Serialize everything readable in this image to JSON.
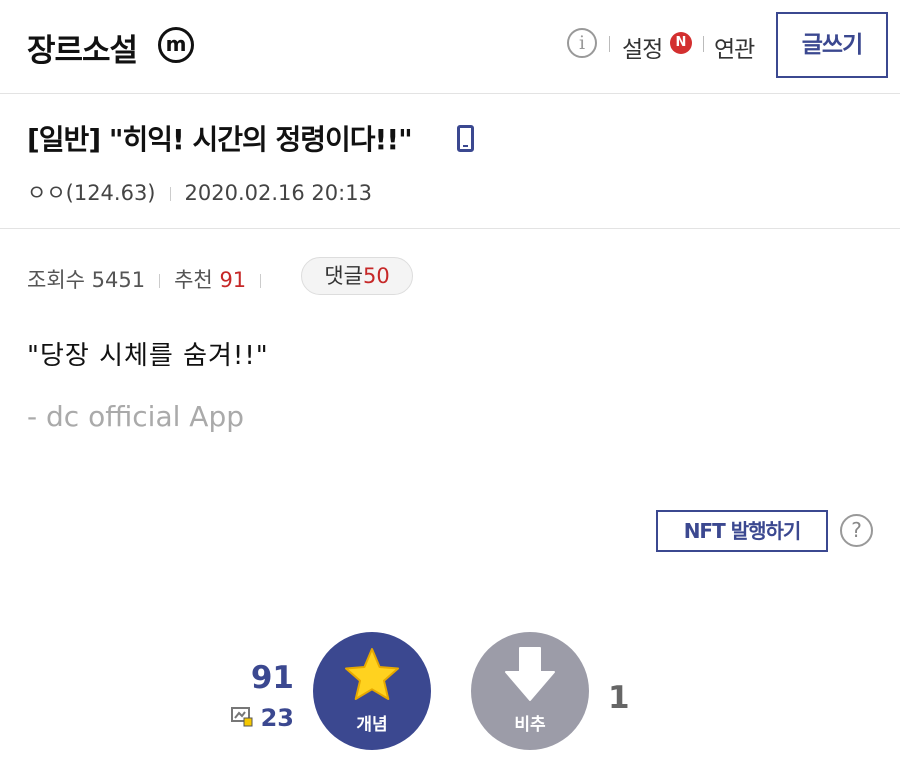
{
  "header": {
    "gallery_name": "장르소설",
    "minor_badge": "m",
    "info_icon": "i",
    "settings_label": "설정",
    "new_badge": "N",
    "related_label": "연관",
    "write_label": "글쓰기"
  },
  "post": {
    "title": "[일반] \"히익! 시간의 정령이다!!\"",
    "author": "ㅇㅇ(124.63)",
    "datetime": "2020.02.16 20:13",
    "views_label": "조회수",
    "views": "5451",
    "recommend_label": "추천",
    "recommend": "91",
    "comments_label": "댓글",
    "comments": "50",
    "body": "\"당장 시체를 숨겨!!\"",
    "signature": "- dc official App"
  },
  "actions": {
    "nft_label": "NFT 발행하기",
    "help_icon": "?"
  },
  "votes": {
    "up_count": "91",
    "fixed_count": "23",
    "up_label": "개념",
    "down_label": "비추",
    "down_count": "1"
  },
  "colors": {
    "accent": "#3b4890",
    "highlight": "#c62828",
    "downvote": "#9c9ca8"
  }
}
